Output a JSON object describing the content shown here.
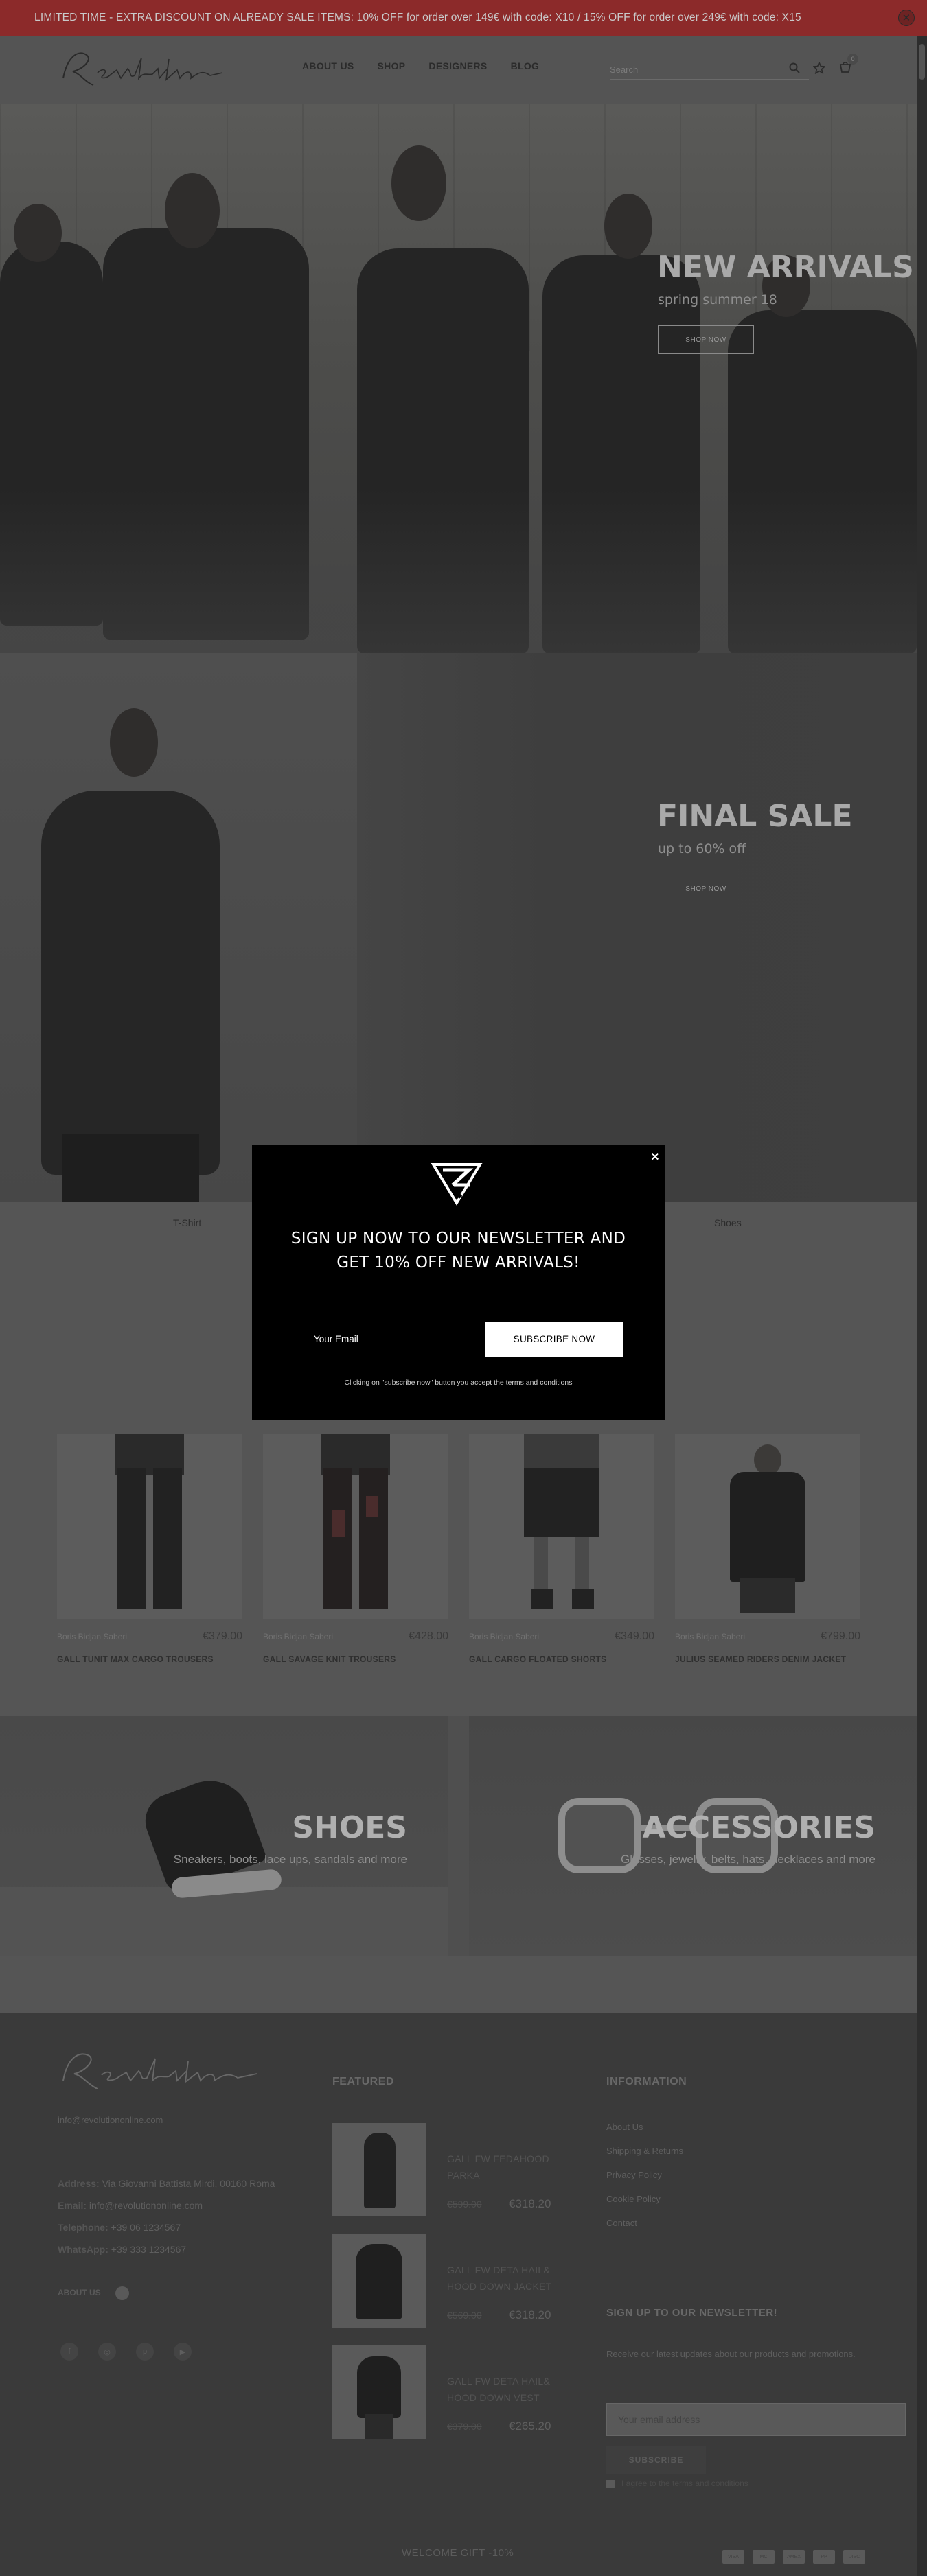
{
  "announcement": {
    "text": "LIMITED TIME - EXTRA DISCOUNT ON ALREADY SALE ITEMS: 10% OFF for order over 149€ with code: X10 / 15% OFF for order over 249€ with code: X15",
    "close_icon": "close-icon"
  },
  "header": {
    "logo_text": "Revolution",
    "nav": [
      "ABOUT US",
      "SHOP",
      "DESIGNERS",
      "BLOG"
    ],
    "search_placeholder": "Search",
    "cart_count": "0"
  },
  "hero1": {
    "title": "NEW ARRIVALS",
    "subtitle": "spring summer 18",
    "button": "SHOP NOW"
  },
  "hero2": {
    "title": "FINAL SALE",
    "subtitle": "up to 60% off",
    "button": "SHOP NOW"
  },
  "categories": [
    "T-Shirt",
    "Shoes"
  ],
  "products": [
    {
      "brand": "Boris Bidjan Saberi",
      "price": "€379.00",
      "name": "GALL TUNIT MAX CARGO TROUSERS"
    },
    {
      "brand": "Boris Bidjan Saberi",
      "price": "€428.00",
      "name": "GALL SAVAGE KNIT TROUSERS"
    },
    {
      "brand": "Boris Bidjan Saberi",
      "price": "€349.00",
      "name": "GALL CARGO FLOATED SHORTS"
    },
    {
      "brand": "Boris Bidjan Saberi",
      "price": "€799.00",
      "name": "JULIUS SEAMED RIDERS DENIM JACKET"
    }
  ],
  "banners": [
    {
      "title": "SHOES",
      "subtitle": "Sneakers, boots, lace ups, sandals and more"
    },
    {
      "title": "ACCESSORIES",
      "subtitle": "Glasses, jewelry, belts, hats, necklaces and more"
    }
  ],
  "footer": {
    "logo_text": "Revolution",
    "email_top": "info@revolutiononline.com",
    "address_label": "Address:",
    "address": "Via Giovanni Battista Mirdi, 00160 Roma",
    "email_label": "Email:",
    "email": "info@revolutiononline.com",
    "phone_label": "Telephone:",
    "phone": "+39 06 1234567",
    "whatsapp_label": "WhatsApp:",
    "whatsapp": "+39 333 1234567",
    "about_label": "ABOUT US",
    "featured_heading": "FEATURED",
    "featured": [
      {
        "name": "GALL FW FEDAHOOD PARKA",
        "old": "€599.00",
        "new": "€318.20"
      },
      {
        "name": "GALL FW DETA HAIL& HOOD DOWN JACKET",
        "old": "€569.00",
        "new": "€318.20"
      },
      {
        "name": "GALL FW DETA HAIL& HOOD DOWN VEST",
        "old": "€379.00",
        "new": "€265.20"
      }
    ],
    "info_heading": "INFORMATION",
    "info_links": [
      "About Us",
      "Shipping & Returns",
      "Privacy Policy",
      "Cookie Policy",
      "Contact"
    ],
    "newsletter_heading": "SIGN UP TO OUR NEWSLETTER!",
    "newsletter_text": "Receive our latest updates about our products and promotions.",
    "newsletter_placeholder": "Your email address",
    "newsletter_button": "SUBSCRIBE",
    "newsletter_consent": "I agree to the terms and conditions",
    "welcome_gift": "WELCOME GIFT -10%",
    "payments": [
      "VISA",
      "MC",
      "AMEX",
      "PP",
      "DISC"
    ]
  },
  "modal": {
    "heading_line1": "SIGN UP NOW TO OUR NEWSLETTER AND",
    "heading_line2": "GET 10% OFF NEW ARRIVALS!",
    "email_placeholder": "Your Email",
    "button": "SUBSCRIBE NOW",
    "note": "Clicking on \"subscribe now\" button you accept the terms and conditions"
  },
  "colors": {
    "announcement_bg": "#8c2a2a",
    "overlay": "#4f4f4f",
    "modal_bg": "#000000"
  }
}
